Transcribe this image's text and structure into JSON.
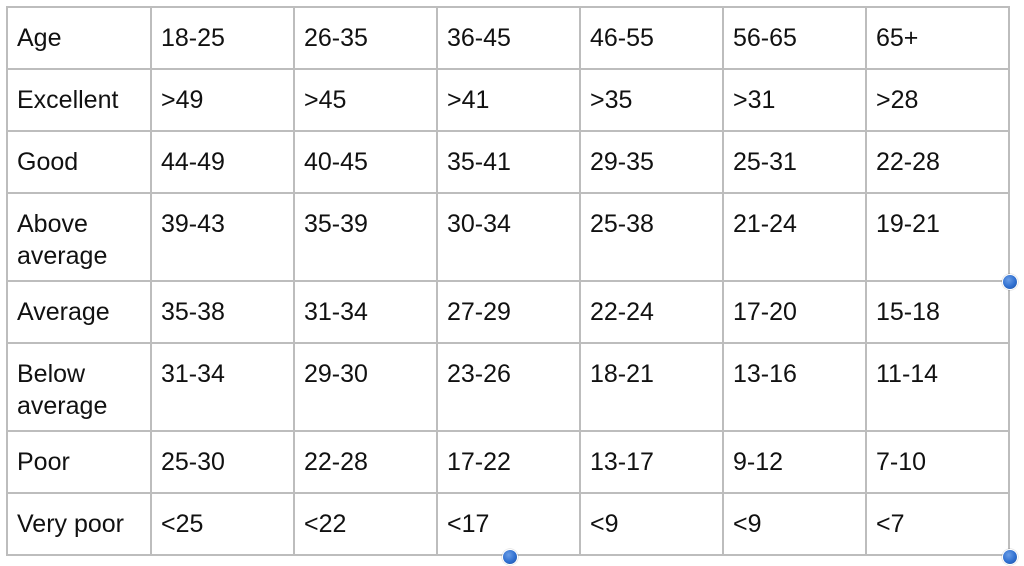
{
  "table": {
    "header": {
      "label": "Age",
      "columns": [
        "18-25",
        "26-35",
        "36-45",
        "46-55",
        "56-65",
        "65+"
      ]
    },
    "rows": [
      {
        "label": "Excellent",
        "values": [
          ">49",
          ">45",
          ">41",
          ">35",
          ">31",
          ">28"
        ]
      },
      {
        "label": "Good",
        "values": [
          "44-49",
          "40-45",
          "35-41",
          "29-35",
          "25-31",
          "22-28"
        ]
      },
      {
        "label": "Above average",
        "values": [
          "39-43",
          "35-39",
          "30-34",
          "25-38",
          "21-24",
          "19-21"
        ]
      },
      {
        "label": "Average",
        "values": [
          "35-38",
          "31-34",
          "27-29",
          "22-24",
          "17-20",
          "15-18"
        ]
      },
      {
        "label": "Below average",
        "values": [
          "31-34",
          "29-30",
          "23-26",
          "18-21",
          "13-16",
          "11-14"
        ]
      },
      {
        "label": "Poor",
        "values": [
          "25-30",
          "22-28",
          "17-22",
          "13-17",
          "9-12",
          "7-10"
        ]
      },
      {
        "label": "Very poor",
        "values": [
          "<25",
          "<22",
          "<17",
          "<9",
          "<9",
          "<7"
        ]
      }
    ]
  },
  "colors": {
    "border": "#bdbdbd",
    "text": "#111111",
    "selection_handle": "#2f6fd0"
  }
}
